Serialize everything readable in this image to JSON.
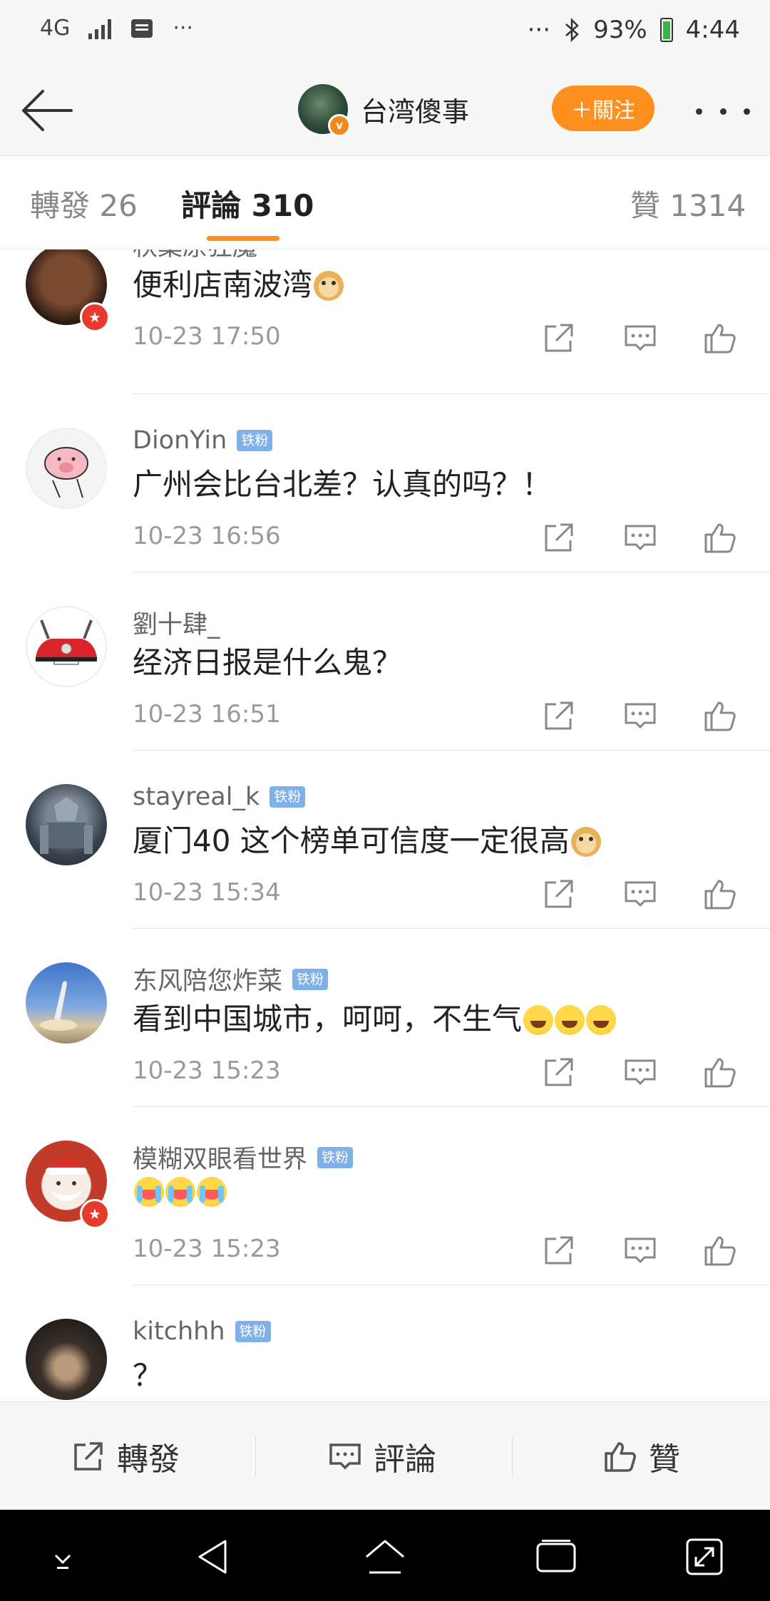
{
  "status_bar": {
    "network": "4G",
    "dots_left": "···",
    "dots_right": "···",
    "battery": "93%",
    "time": "4:44"
  },
  "header": {
    "title": "台湾傻事",
    "follow_label": "＋關注"
  },
  "tabs": [
    {
      "label": "轉發 26"
    },
    {
      "label": "評論 310"
    },
    {
      "label": "贊 1314"
    }
  ],
  "comments": [
    {
      "user": "秋葉原狂魔",
      "badge": "",
      "text": "便利店南波湾",
      "emoji": "doge",
      "time": "10-23 17:50"
    },
    {
      "user": "DionYin",
      "badge": "铁粉",
      "text": "广州会比台北差？认真的吗？！",
      "emoji": "",
      "time": "10-23 16:56"
    },
    {
      "user": "劉十肆_",
      "badge": "",
      "text": "经济日报是什么鬼？",
      "emoji": "",
      "time": "10-23 16:51"
    },
    {
      "user": "stayreal_k",
      "badge": "铁粉",
      "text": "厦门40 这个榜单可信度一定很高",
      "emoji": "doge",
      "time": "10-23 15:34"
    },
    {
      "user": "东风陪您炸菜",
      "badge": "铁粉",
      "text": "看到中国城市，呵呵，不生气",
      "emoji": "laugh",
      "time": "10-23 15:23"
    },
    {
      "user": "模糊双眼看世界",
      "badge": "铁粉",
      "text": "",
      "emoji": "cry",
      "time": "10-23 15:23"
    },
    {
      "user": "kitchhh",
      "badge": "铁粉",
      "text": "？",
      "emoji": "",
      "time": ""
    }
  ],
  "bottom_bar": {
    "repost_label": "轉發",
    "comment_label": "評論",
    "like_label": "贊"
  },
  "colors": {
    "accent": "#ff8f1f",
    "fan_badge": "#7fb0e8",
    "vip_badge": "#e8392f"
  },
  "icons": [
    "back-arrow-icon",
    "more-dots-icon",
    "repost-icon",
    "comment-icon",
    "like-icon",
    "bluetooth-icon",
    "battery-icon",
    "signal-icon",
    "message-icon"
  ]
}
